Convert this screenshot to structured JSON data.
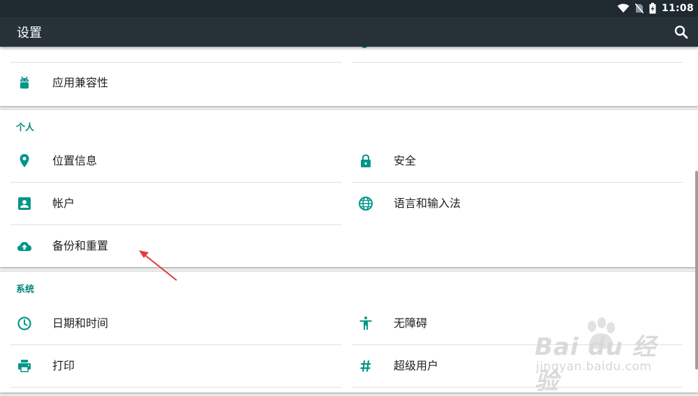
{
  "status_bar": {
    "time": "11:08",
    "icons": [
      "wifi-icon",
      "no-sim-icon",
      "battery-charging-icon"
    ]
  },
  "toolbar": {
    "title": "设置",
    "search_icon": "search-icon"
  },
  "top_card": {
    "items": [
      {
        "label": "应用兼容性",
        "icon": "android-icon"
      }
    ]
  },
  "personal": {
    "header": "个人",
    "items": [
      {
        "label": "位置信息",
        "icon": "location-pin-icon"
      },
      {
        "label": "安全",
        "icon": "lock-icon"
      },
      {
        "label": "帐户",
        "icon": "account-box-icon"
      },
      {
        "label": "语言和输入法",
        "icon": "globe-icon"
      },
      {
        "label": "备份和重置",
        "icon": "cloud-upload-icon"
      }
    ]
  },
  "system": {
    "header": "系统",
    "items": [
      {
        "label": "日期和时间",
        "icon": "clock-icon"
      },
      {
        "label": "无障碍",
        "icon": "accessibility-icon"
      },
      {
        "label": "打印",
        "icon": "printer-icon"
      },
      {
        "label": "超级用户",
        "icon": "hash-icon"
      }
    ]
  },
  "watermark": {
    "main": "Bai du 经验",
    "sub": "jingyan.baidu.com"
  },
  "colors": {
    "accent": "#009688",
    "header_text": "#00897b",
    "toolbar": "#263238",
    "status_bar": "#1f2a30",
    "annotation_arrow": "#e53935"
  }
}
